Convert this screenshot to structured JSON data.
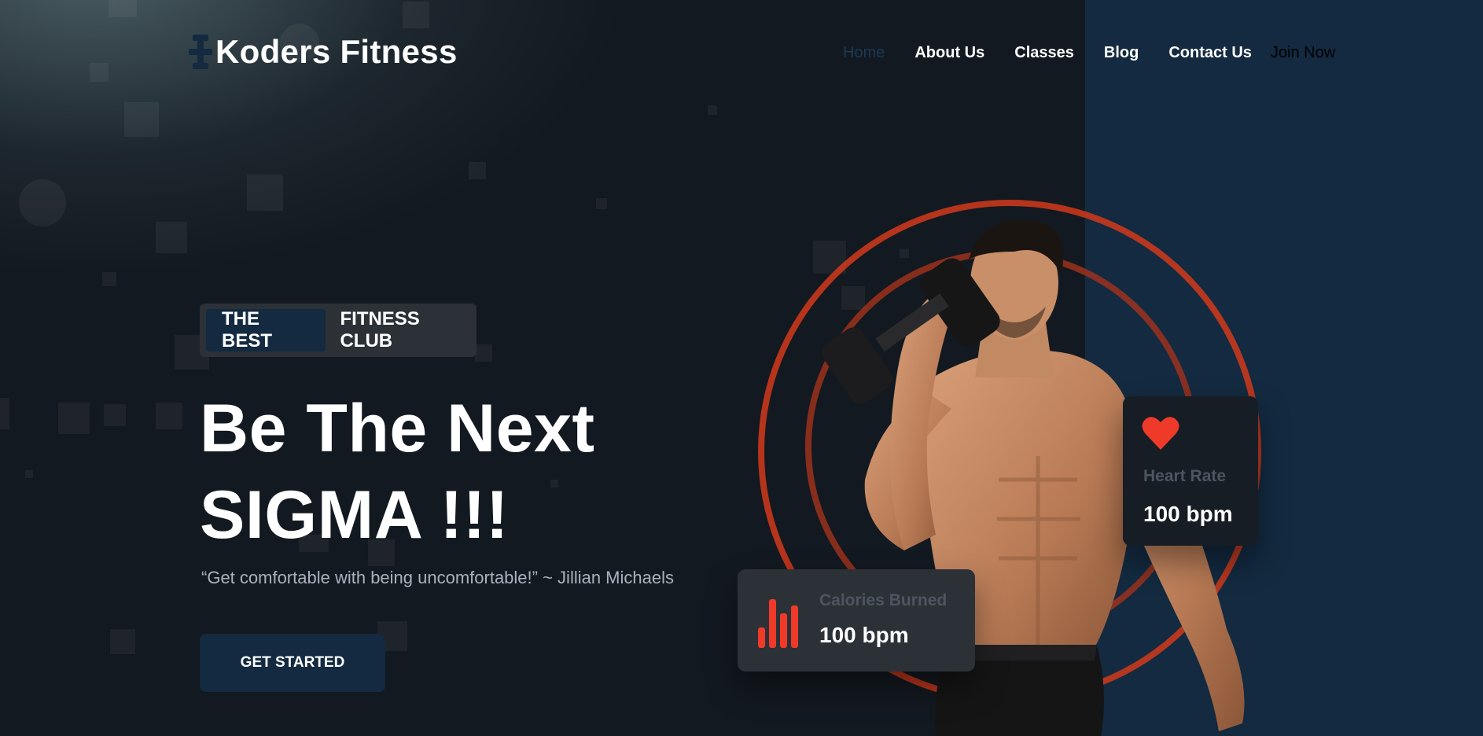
{
  "brand": {
    "name": "Koders Fitness",
    "logo_icon": "dumbbell-icon"
  },
  "nav": {
    "items": [
      "Home",
      "About Us",
      "Classes",
      "Blog",
      "Contact Us"
    ],
    "active": "Home",
    "join_label": "Join Now"
  },
  "hero": {
    "tag_primary": "THE BEST",
    "tag_secondary": "FITNESS CLUB",
    "headline_line1": "Be The Next",
    "headline_line2": "SIGMA !!!",
    "quote": "“Get comfortable with being uncomfortable!” ~ Jillian Michaels",
    "cta_label": "GET STARTED"
  },
  "stats": {
    "heart": {
      "icon": "heart-icon",
      "label": "Heart Rate",
      "value": "100 bpm"
    },
    "calories": {
      "icon": "bar-chart-icon",
      "label": "Calories Burned",
      "value": "100 bpm"
    }
  },
  "colors": {
    "background": "#131920",
    "panel_right": "#132a40",
    "accent": "#ef3a2a",
    "ring": "#d2391b",
    "card_dark": "#171d24",
    "card_gray": "#2c3138",
    "quote_text": "#a9b2bd"
  }
}
